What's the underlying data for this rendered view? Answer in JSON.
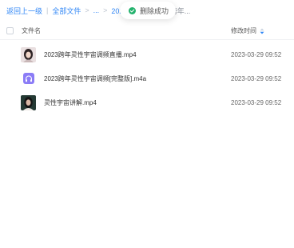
{
  "breadcrumb": {
    "back": "返回上一级",
    "all_files": "全部文件",
    "ellipsis": "...",
    "folder": "2023上新",
    "current": "2023跨年..."
  },
  "toast": {
    "message": "删除成功",
    "color": "#23b26d"
  },
  "table": {
    "col_name": "文件名",
    "col_time": "修改时间"
  },
  "files": [
    {
      "name": "2023跨年灵性宇宙调频直播.mp4",
      "time": "2023-03-29 09:52",
      "icon": "video-thumbnail"
    },
    {
      "name": "2023跨年灵性宇宙调频[完整版].m4a",
      "time": "2023-03-29 09:52",
      "icon": "audio-file-icon"
    },
    {
      "name": "灵性宇宙讲解.mp4",
      "time": "2023-03-29 09:52",
      "icon": "video-thumbnail"
    }
  ],
  "colors": {
    "link": "#2f86f6",
    "audio": "#8b7cf6"
  }
}
